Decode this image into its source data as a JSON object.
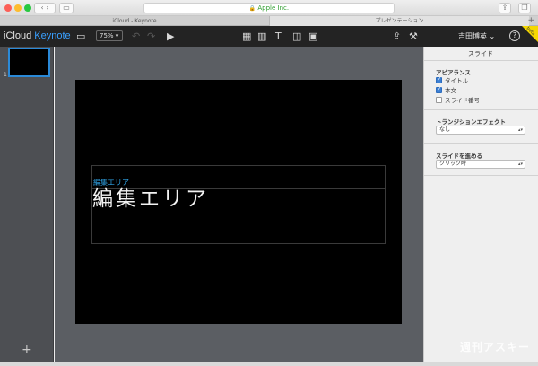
{
  "browser": {
    "address": "Apple Inc.",
    "tabs": [
      "iCloud - Keynote",
      "プレゼンテーション"
    ],
    "new_tab": "+"
  },
  "app": {
    "brand_icloud": "iCloud",
    "brand_keynote": "Keynote",
    "zoom": "75%",
    "user": "吉田博英",
    "help": "?",
    "beta": "beta"
  },
  "rail": {
    "slide_number": "1",
    "add": "+"
  },
  "slide": {
    "title_small": "編集エリア",
    "title_big": "編集エリア"
  },
  "inspector": {
    "title": "スライド",
    "appearance": {
      "heading": "アピアランス",
      "items": [
        {
          "label": "タイトル",
          "checked": true
        },
        {
          "label": "本文",
          "checked": true
        },
        {
          "label": "スライド番号",
          "checked": false
        }
      ]
    },
    "transition": {
      "heading": "トランジションエフェクト",
      "value": "なし"
    },
    "advance": {
      "heading": "スライドを進める",
      "value": "クリック時"
    }
  },
  "watermark": "週刊アスキー",
  "colors": {
    "accent": "#2fa3e6",
    "toolbar": "#232323",
    "beta": "#f5d800"
  }
}
